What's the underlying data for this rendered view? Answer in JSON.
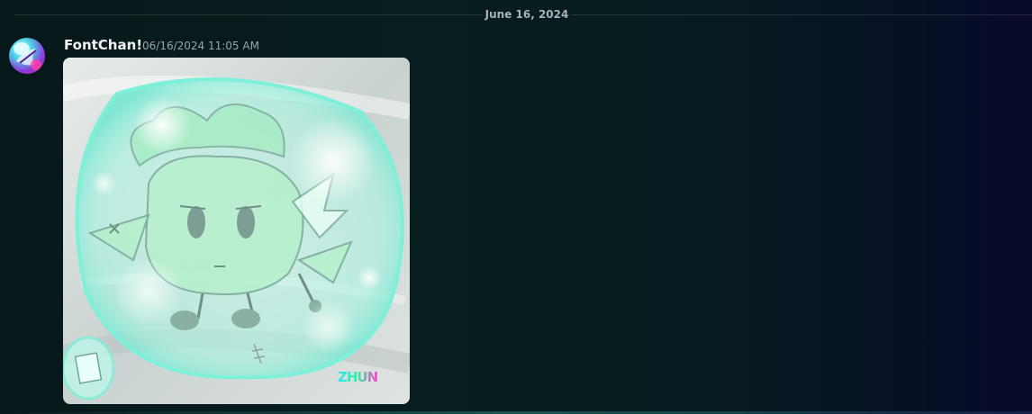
{
  "date_divider": "June 16, 2024",
  "message": {
    "username": "FontChan!",
    "timestamp": "06/16/2024 11:05 AM",
    "attachment_signature": "ZHUN"
  },
  "colors": {
    "username": "#f2f3f5",
    "timestamp": "#9aa3ab",
    "divider_text": "#a8b0b8",
    "bubble": "#9ff0e0"
  }
}
